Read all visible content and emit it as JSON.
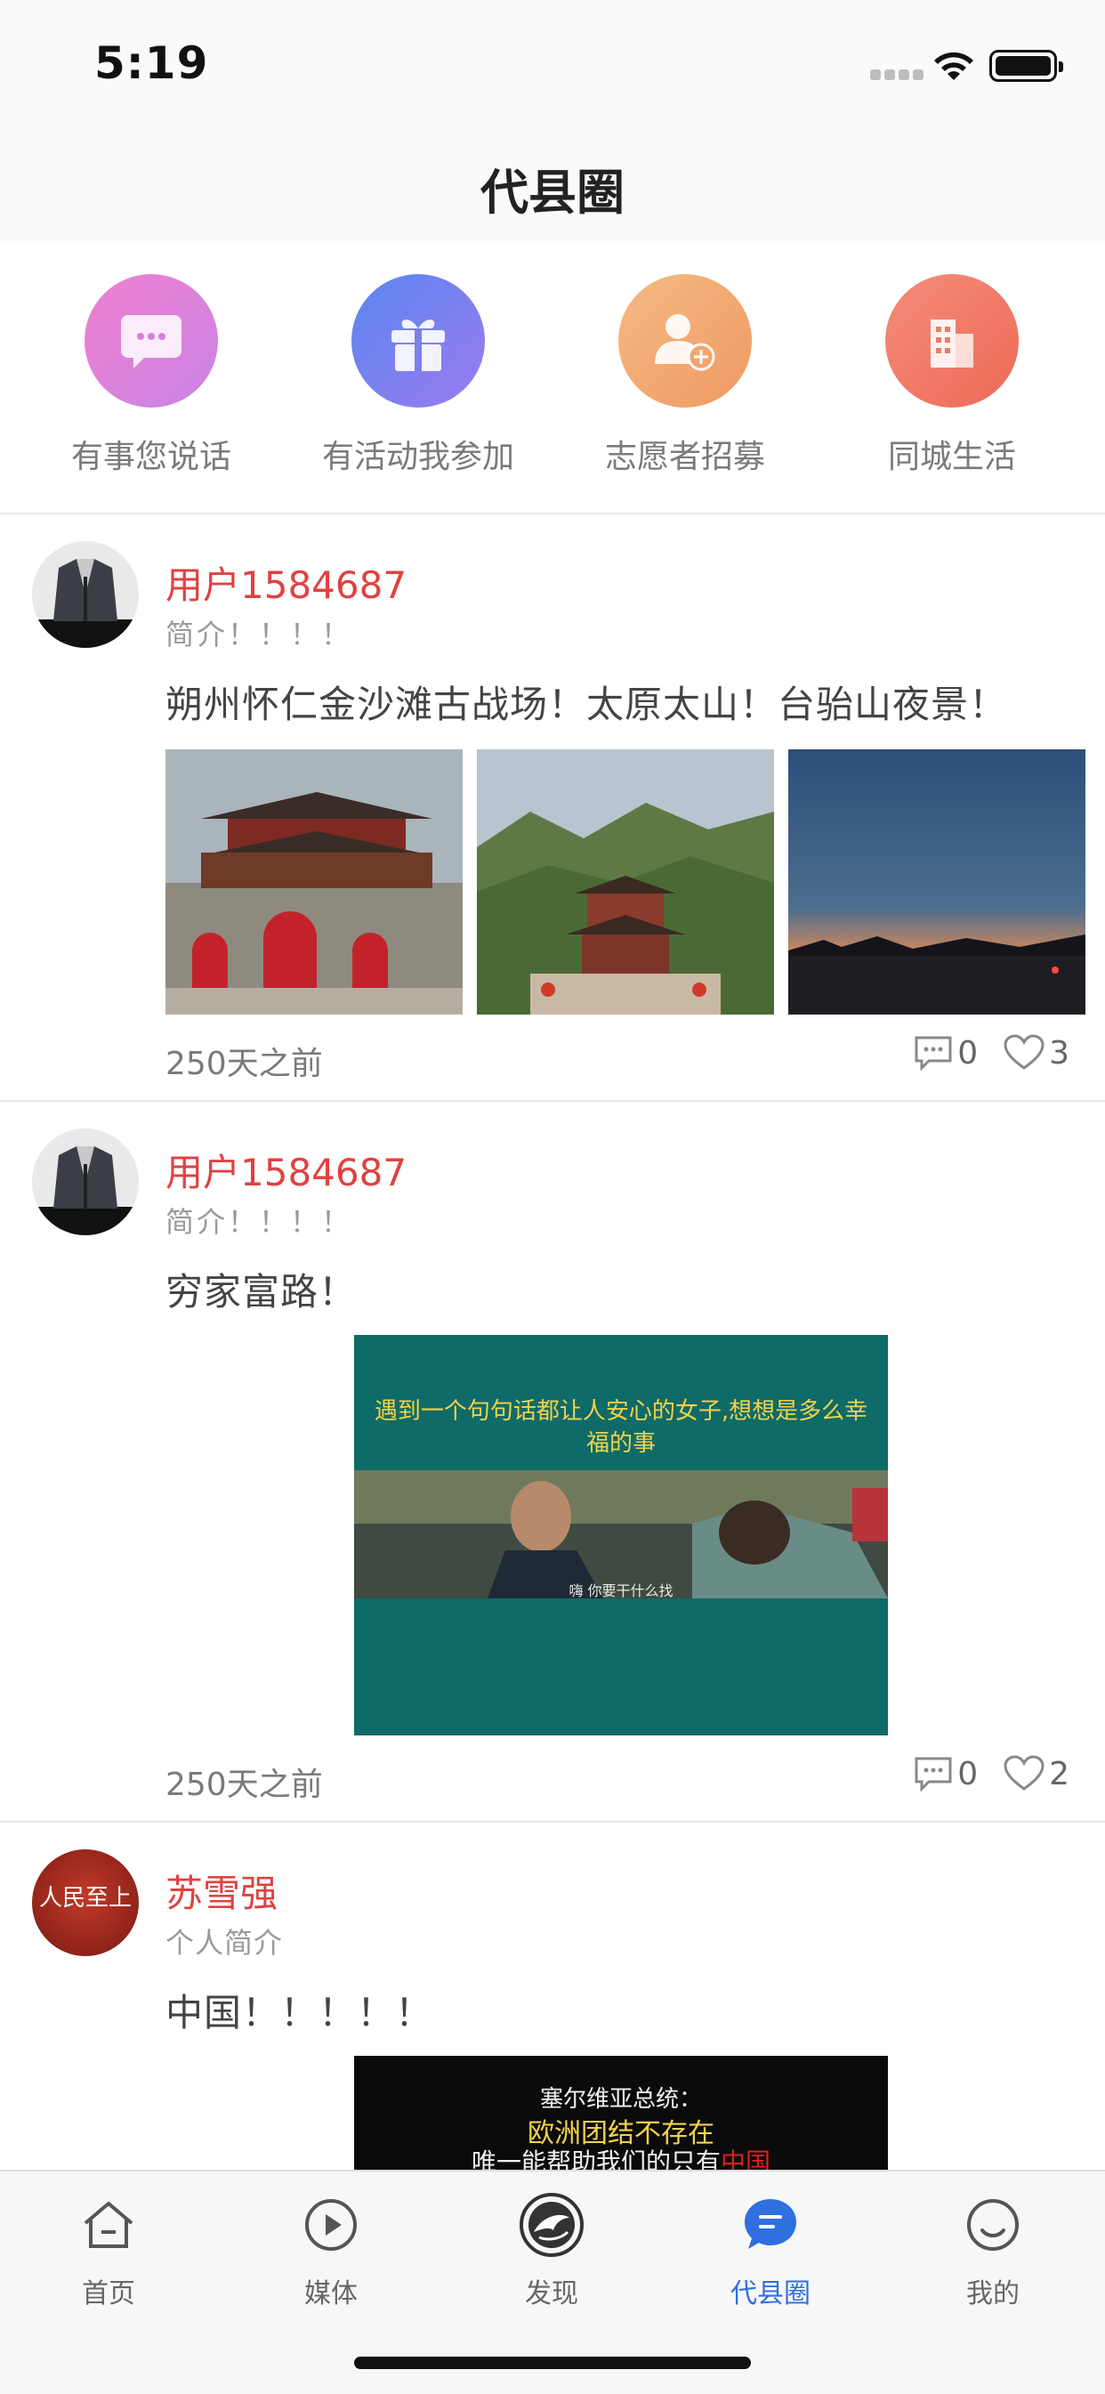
{
  "status": {
    "time": "5:19"
  },
  "header": {
    "title": "代县圈"
  },
  "categories": [
    {
      "label": "有事您说话",
      "icon": "chat-icon",
      "color_from": "#f07fd0",
      "color_to": "#c984e6"
    },
    {
      "label": "有活动我参加",
      "icon": "gift-icon",
      "color_from": "#5a87f0",
      "color_to": "#9c7af0"
    },
    {
      "label": "志愿者招募",
      "icon": "volunteer-add-icon",
      "color_from": "#f6b984",
      "color_to": "#ee9a62"
    },
    {
      "label": "同城生活",
      "icon": "building-icon",
      "color_from": "#f58d7a",
      "color_to": "#ec6a56"
    }
  ],
  "posts": [
    {
      "username": "用户1584687",
      "bio": "简介！！！！",
      "content": "朔州怀仁金沙滩古战场！太原太山！台骀山夜景！",
      "time": "250天之前",
      "comments": "0",
      "likes": "3",
      "images": [
        "city-gate-photo",
        "mountain-pavilion-photo",
        "night-sunset-photo"
      ]
    },
    {
      "username": "用户1584687",
      "bio": "简介！！！！",
      "content": "穷家富路！",
      "time": "250天之前",
      "comments": "0",
      "likes": "2",
      "video_caption": "遇到一个句句话都让人安心的女子,想想是多么幸福的事",
      "video_subtitle": "嗨 你要干什么找"
    },
    {
      "username": "苏雪强",
      "bio": "个人简介",
      "content": "中国！！！！！",
      "video_caption_line1": "塞尔维亚总统：",
      "video_caption_line2": "欧洲团结不存在",
      "video_caption_line3_prefix": "唯一能帮助我们的只有",
      "video_caption_line3_highlight": "中国",
      "avatar_text": "人民至上"
    }
  ],
  "tabs": [
    {
      "label": "首页",
      "icon": "home-icon",
      "active": false
    },
    {
      "label": "媒体",
      "icon": "play-icon",
      "active": false
    },
    {
      "label": "发现",
      "icon": "discover-icon",
      "active": false
    },
    {
      "label": "代县圈",
      "icon": "message-icon",
      "active": true
    },
    {
      "label": "我的",
      "icon": "smile-icon",
      "active": false
    }
  ],
  "colors": {
    "accent": "#2f6fe0",
    "username": "#e04141"
  }
}
